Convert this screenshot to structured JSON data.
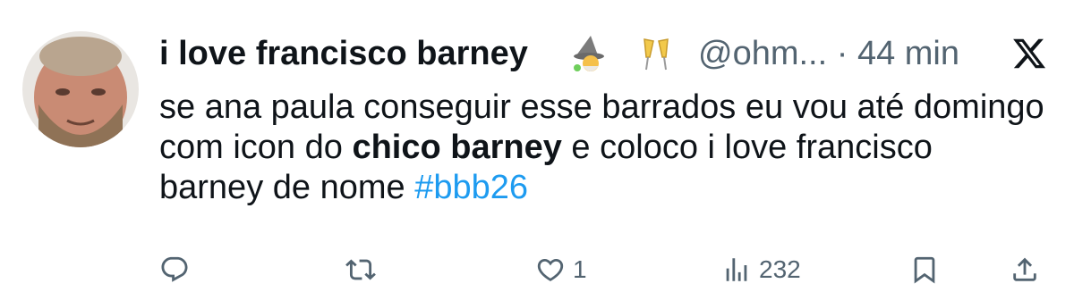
{
  "tweet": {
    "display_name": "i love francisco barney",
    "emoji_1": "🧙",
    "emoji_2": "🥂",
    "handle": "@ohm...",
    "separator": "·",
    "time": "44 min",
    "text_part1": "se ana paula conseguir esse barrados eu vou até domingo com icon do ",
    "text_bold": "chico barney",
    "text_part2": " e coloco i love francisco barney de nome ",
    "hashtag": "#bbb26"
  },
  "actions": {
    "reply_icon": "reply-icon",
    "retweet_icon": "retweet-icon",
    "like_icon": "heart-icon",
    "like_count": "1",
    "views_icon": "views-icon",
    "views_count": "232",
    "bookmark_icon": "bookmark-icon",
    "share_icon": "share-icon"
  },
  "colors": {
    "text": "#0f1419",
    "secondary": "#536471",
    "link": "#1d9bf0"
  }
}
